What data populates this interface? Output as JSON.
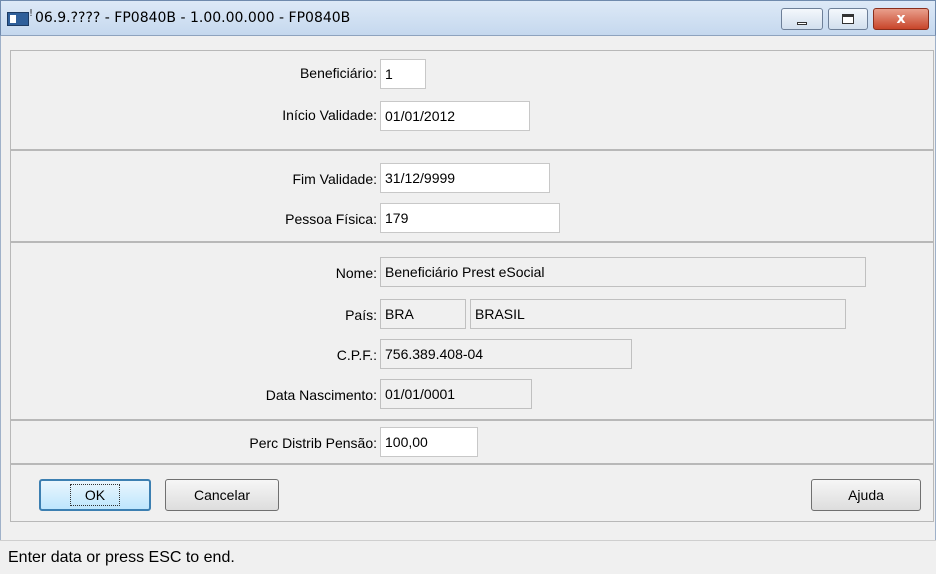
{
  "window": {
    "title": "06.9.???? - FP0840B - 1.00.00.000 - FP0840B",
    "minimize_label": "",
    "maximize_label": "",
    "close_label": "x"
  },
  "form": {
    "beneficiario": {
      "label": "Beneficiário:",
      "value": "1"
    },
    "inicio_validade": {
      "label": "Início Validade:",
      "value": "01/01/2012"
    },
    "fim_validade": {
      "label": "Fim Validade:",
      "value": "31/12/9999"
    },
    "pessoa_fisica": {
      "label": "Pessoa Física:",
      "value": "179"
    },
    "nome": {
      "label": "Nome:",
      "value": "Beneficiário Prest eSocial"
    },
    "pais": {
      "label": "País:",
      "code": "BRA",
      "name": "BRASIL"
    },
    "cpf": {
      "label": "C.P.F.:",
      "value": "756.389.408-04"
    },
    "data_nascimento": {
      "label": "Data Nascimento:",
      "value": "01/01/0001"
    },
    "perc_distrib_pensao": {
      "label": "Perc Distrib Pensão:",
      "value": "100,00"
    }
  },
  "buttons": {
    "ok": "OK",
    "cancelar": "Cancelar",
    "ajuda": "Ajuda"
  },
  "status": {
    "text": "Enter data or press ESC to end."
  }
}
